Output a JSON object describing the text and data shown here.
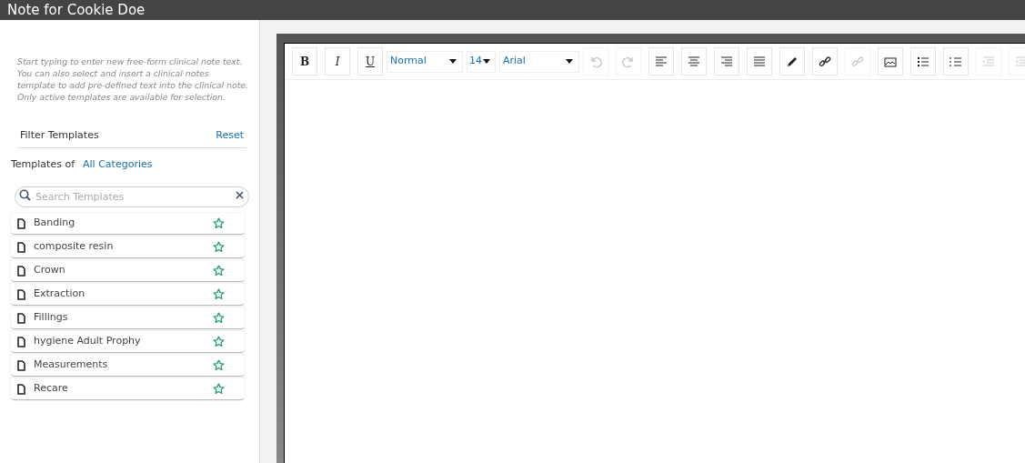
{
  "window": {
    "title": "Note for Cookie Doe"
  },
  "sidebar": {
    "instructions": "Start typing to enter new free-form clinical note text. You can also select and insert a clinical notes template to add pre-defined text into the clinical note. Only active templates are available for selection.",
    "filter_title": "Filter Templates",
    "reset_link": "Reset",
    "templates_of_label": "Templates of",
    "category_link": "All Categories",
    "search": {
      "placeholder": "Search Templates"
    },
    "templates": [
      {
        "name": "Banding"
      },
      {
        "name": "composite resin"
      },
      {
        "name": "Crown"
      },
      {
        "name": "Extraction"
      },
      {
        "name": "Fillings"
      },
      {
        "name": "hygiene Adult Prophy"
      },
      {
        "name": "Measurements"
      },
      {
        "name": "Recare"
      }
    ]
  },
  "toolbar": [
    {
      "kind": "bold",
      "label": "B",
      "disabled": false
    },
    {
      "kind": "italic",
      "label": "I",
      "disabled": false
    },
    {
      "kind": "underline",
      "label": "U",
      "disabled": false
    },
    {
      "kind": "style-select",
      "label": "Normal"
    },
    {
      "kind": "size-select",
      "label": "14"
    },
    {
      "kind": "font-select",
      "label": "Arial"
    },
    {
      "kind": "undo",
      "disabled": true
    },
    {
      "kind": "redo",
      "disabled": true
    },
    {
      "kind": "align-left",
      "disabled": false
    },
    {
      "kind": "align-center",
      "disabled": false
    },
    {
      "kind": "align-right",
      "disabled": false
    },
    {
      "kind": "justify",
      "disabled": false
    },
    {
      "kind": "pen",
      "disabled": false
    },
    {
      "kind": "link",
      "disabled": false
    },
    {
      "kind": "unlink",
      "disabled": true
    },
    {
      "kind": "image",
      "disabled": false
    },
    {
      "kind": "bullet-list",
      "disabled": false
    },
    {
      "kind": "numbered-list",
      "disabled": false
    },
    {
      "kind": "indent",
      "disabled": true
    },
    {
      "kind": "outdent",
      "disabled": true
    }
  ]
}
